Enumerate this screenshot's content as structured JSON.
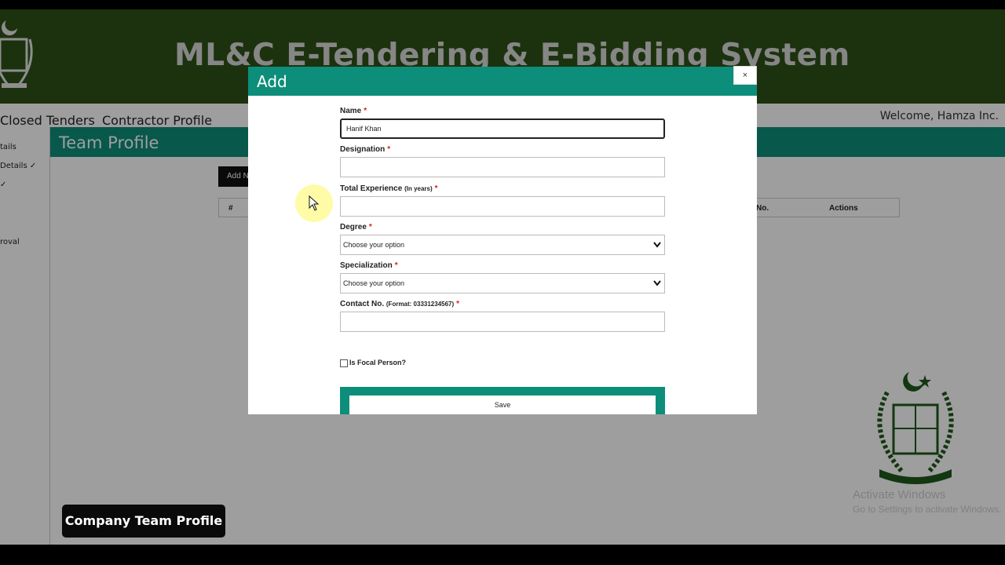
{
  "header": {
    "title": "ML&C E-Tendering & E-Bidding System",
    "emblem": "pakistan-emblem-icon"
  },
  "nav": {
    "links": [
      "Closed Tenders",
      "Contractor Profile"
    ],
    "welcome": "Welcome, Hamza Inc."
  },
  "sidebar": {
    "items": [
      "tails",
      "Details ✓",
      "✓",
      "roval"
    ]
  },
  "page": {
    "section_title": "Team Profile",
    "add_button": "Add N",
    "table_headers": {
      "num": "#",
      "contact": "No.",
      "actions": "Actions"
    }
  },
  "modal": {
    "title": "Add",
    "close": "×",
    "fields": {
      "name": {
        "label": "Name",
        "value": "Hanif Khan"
      },
      "designation": {
        "label": "Designation",
        "value": ""
      },
      "experience": {
        "label": "Total Experience",
        "hint": "(In years)",
        "value": ""
      },
      "degree": {
        "label": "Degree",
        "selected": "Choose your option"
      },
      "specialization": {
        "label": "Specialization",
        "selected": "Choose your option"
      },
      "contact": {
        "label": "Contact No.",
        "hint": "(Format: 03331234567)",
        "value": ""
      }
    },
    "required_mark": "*",
    "focal_label": "Is Focal Person?",
    "focal_checked": false,
    "save_label": "Save"
  },
  "caption": "Company Team Profile",
  "watermark": {
    "line1": "Activate Windows",
    "line2": "Go to Settings to activate Windows."
  },
  "colors": {
    "header_green": "#2e5218",
    "teal": "#0d8e7b",
    "required_red": "#d42020"
  }
}
